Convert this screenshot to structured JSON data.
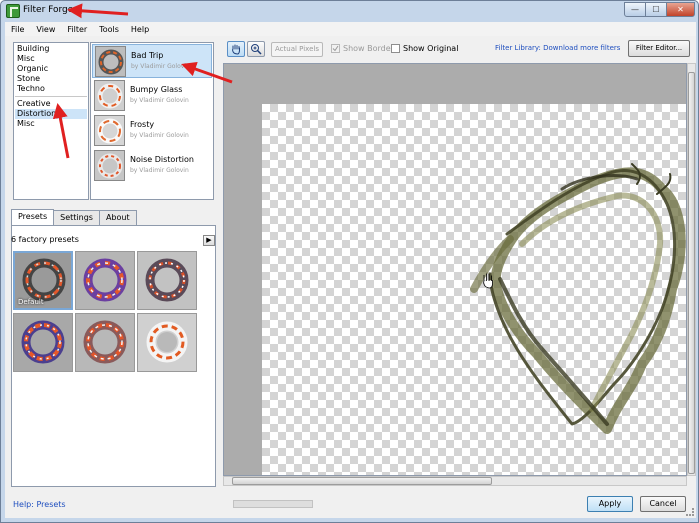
{
  "window": {
    "title": "Filter Forge",
    "minimize_glyph": "—",
    "maximize_glyph": "☐",
    "close_glyph": "✕"
  },
  "menu": [
    "File",
    "View",
    "Filter",
    "Tools",
    "Help"
  ],
  "categories": {
    "group1": [
      "Building",
      "Misc",
      "Organic",
      "Stone",
      "Techno"
    ],
    "group2": [
      "Creative",
      "Distortions",
      "Misc"
    ],
    "selected": "Distortions"
  },
  "filters": [
    {
      "name": "Bad Trip",
      "author": "by Vladimir Golovin",
      "selected": true
    },
    {
      "name": "Bumpy Glass",
      "author": "by Vladimir Golovin",
      "selected": false
    },
    {
      "name": "Frosty",
      "author": "by Vladimir Golovin",
      "selected": false
    },
    {
      "name": "Noise Distortion",
      "author": "by Vladimir Golovin",
      "selected": false
    }
  ],
  "tabs": [
    "Presets",
    "Settings",
    "About"
  ],
  "presets": {
    "count_label": "6 factory presets",
    "arrow_glyph": "▶",
    "items": [
      "Default",
      "",
      "",
      "",
      "",
      ""
    ]
  },
  "help_link": "Help: Presets",
  "toolbar": {
    "actual_pixels": "Actual Pixels",
    "show_border": "Show Border",
    "show_original": "Show Original",
    "library_link": "Filter Library: Download more filters",
    "filter_editor": "Filter Editor..."
  },
  "buttons": {
    "apply": "Apply",
    "cancel": "Cancel"
  },
  "colors": {
    "annotation": "#e02020",
    "link": "#1f4fbf",
    "selection": "#cde4f8",
    "ring": "#6b6d3e"
  },
  "icons": {
    "hand_tool": "hand-icon",
    "zoom_tool": "zoom-icon"
  }
}
